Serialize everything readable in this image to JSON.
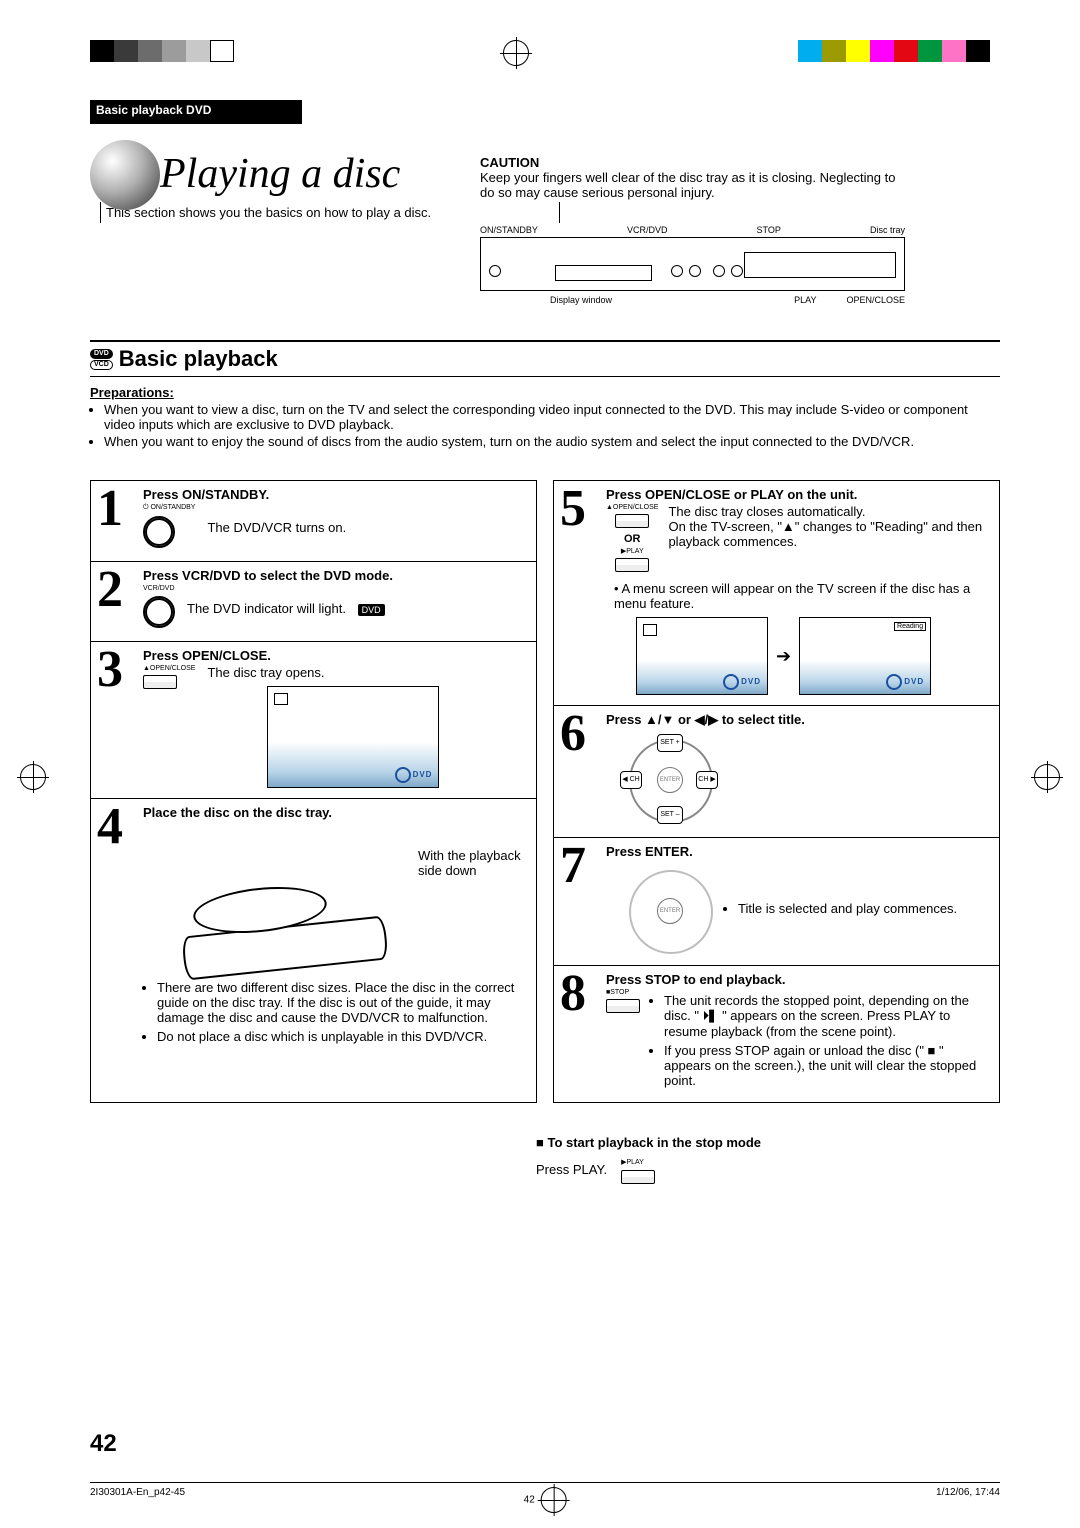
{
  "header": {
    "section": "Basic playback DVD"
  },
  "intro": {
    "title": "Playing a disc",
    "subtitle": "This section shows you the basics on how to play a disc."
  },
  "caution": {
    "label": "CAUTION",
    "text": "Keep your fingers well clear of the disc tray as it is closing. Neglecting to do so may cause serious personal injury."
  },
  "diagram": {
    "top": {
      "a": "ON/STANDBY",
      "b": "VCR/DVD",
      "c": "STOP",
      "d": "Disc tray"
    },
    "bottom": {
      "a": "Display window",
      "b": "PLAY",
      "c": "OPEN/CLOSE"
    }
  },
  "basic": {
    "title": "Basic playback"
  },
  "prep": {
    "label": "Preparations:",
    "items": [
      "When you want to view a disc, turn on the TV and select the corresponding video input connected to the DVD. This may include S-video or component video inputs which are exclusive to DVD playback.",
      "When you want to enjoy the sound of discs from the audio system, turn on the audio system and select the input connected to the DVD/VCR."
    ]
  },
  "steps_left": [
    {
      "n": "1",
      "title": "Press ON/STANDBY.",
      "body": "The DVD/VCR turns on.",
      "mini": "⏻ ON/STANDBY"
    },
    {
      "n": "2",
      "title": "Press VCR/DVD to select the DVD mode.",
      "body": "The DVD indicator will light.",
      "mini": "VCR/DVD",
      "chip": "DVD"
    },
    {
      "n": "3",
      "title": "Press OPEN/CLOSE.",
      "body": "The disc tray opens.",
      "mini": "▲OPEN/CLOSE"
    },
    {
      "n": "4",
      "title": "Place the disc on the disc tray.",
      "body": "With the playback side down",
      "bullets": [
        "There are two different disc sizes. Place the disc in the correct guide on the disc tray. If the disc is out of the guide, it may damage the disc and cause the DVD/VCR to malfunction.",
        "Do not place a disc which is unplayable in this DVD/VCR."
      ]
    }
  ],
  "steps_right": [
    {
      "n": "5",
      "title": "Press OPEN/CLOSE or PLAY on the unit.",
      "body_lines": [
        "The disc tray closes automatically.",
        "On the TV-screen, \"▲\" changes to \"Reading\" and then playback commences."
      ],
      "mini1": "▲OPEN/CLOSE",
      "mini2": "▶PLAY",
      "or": "OR",
      "bullets": [
        "A menu screen will appear on the TV screen if the disc has a menu feature."
      ],
      "reading": "Reading"
    },
    {
      "n": "6",
      "title": "Press ▲/▼ or ◀/▶ to select title.",
      "pad": {
        "up": "SET +",
        "dn": "SET –",
        "lf": "◀ CH",
        "rt": "CH ▶",
        "ctr": "ENTER"
      }
    },
    {
      "n": "7",
      "title": "Press ENTER.",
      "bullets": [
        "Title is selected and play commences."
      ],
      "pad": {
        "ctr": "ENTER"
      }
    },
    {
      "n": "8",
      "title": "Press STOP to end playback.",
      "mini": "■STOP",
      "bullets": [
        "The unit records the stopped point, depending on the disc. \" ⏵▍\" appears on the screen. Press PLAY to resume playback (from the scene point).",
        "If you press STOP again or unload the disc (\" ■ \" appears on the screen.), the unit will clear the stopped point."
      ]
    }
  ],
  "resume": {
    "heading": "■ To start playback in the stop mode",
    "body": "Press PLAY.",
    "mini": "▶PLAY"
  },
  "page_number": "42",
  "footer": {
    "file": "2I30301A-En_p42-45",
    "page": "42",
    "date": "1/12/06, 17:44"
  }
}
